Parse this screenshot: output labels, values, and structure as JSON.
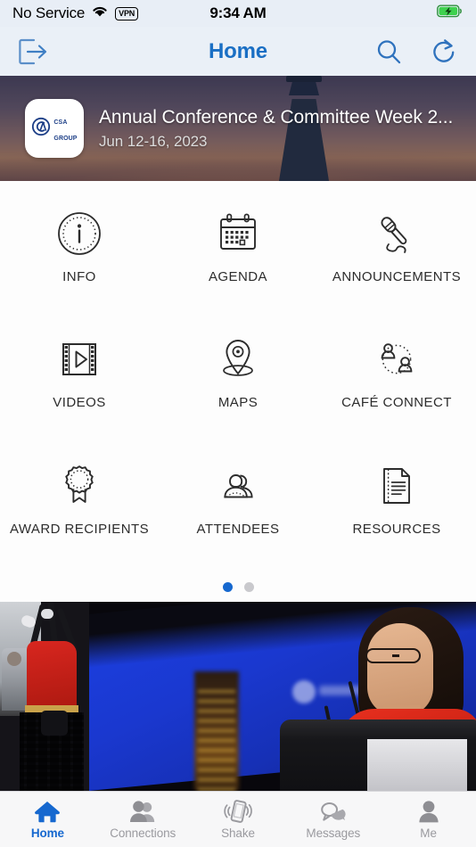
{
  "statusbar": {
    "carrier": "No Service",
    "vpn_badge": "VPN",
    "time": "9:34 AM",
    "wifi_icon": "wifi-icon",
    "battery_icon": "battery-charging-icon"
  },
  "navbar": {
    "title": "Home",
    "logout_icon": "logout-icon",
    "search_icon": "search-icon",
    "refresh_icon": "refresh-icon"
  },
  "banner": {
    "logo_line1": "CSA",
    "logo_line2": "GROUP",
    "logo_mark": "csa-monogram-icon",
    "title": "Annual Conference & Committee Week 2...",
    "date": "Jun 12-16, 2023",
    "background_icon": "lighthouse-image"
  },
  "grid": {
    "tiles": [
      {
        "label": "INFO",
        "icon": "info-circle-icon"
      },
      {
        "label": "AGENDA",
        "icon": "calendar-icon"
      },
      {
        "label": "ANNOUNCEMENTS",
        "icon": "microphone-icon"
      },
      {
        "label": "VIDEOS",
        "icon": "film-play-icon"
      },
      {
        "label": "MAPS",
        "icon": "map-pin-icon"
      },
      {
        "label": "CAFÉ CONNECT",
        "icon": "people-connect-icon"
      },
      {
        "label": "AWARD RECIPIENTS",
        "icon": "award-rosette-icon"
      },
      {
        "label": "ATTENDEES",
        "icon": "attendees-icon"
      },
      {
        "label": "RESOURCES",
        "icon": "document-lines-icon"
      }
    ],
    "pager": {
      "count": 2,
      "active_index": 0
    }
  },
  "photos": [
    {
      "name": "bagpiper-photo",
      "alt": "Bagpiper in red uniform"
    },
    {
      "name": "keynote-speaker-photo",
      "alt": "Speaker at podium with blue screen"
    }
  ],
  "tabbar": {
    "active_index": 0,
    "tabs": [
      {
        "label": "Home",
        "icon": "home-icon"
      },
      {
        "label": "Connections",
        "icon": "connections-icon"
      },
      {
        "label": "Shake",
        "icon": "shake-phone-icon"
      },
      {
        "label": "Messages",
        "icon": "chat-bubbles-icon"
      },
      {
        "label": "Me",
        "icon": "person-icon"
      }
    ]
  },
  "colors": {
    "accent": "#1668cf",
    "nav_title": "#1a6fc4",
    "tab_inactive": "#9a9a9f",
    "icon_stroke": "#2c2c2c",
    "status_bg": "#e8eef6",
    "battery_green": "#34c759"
  }
}
